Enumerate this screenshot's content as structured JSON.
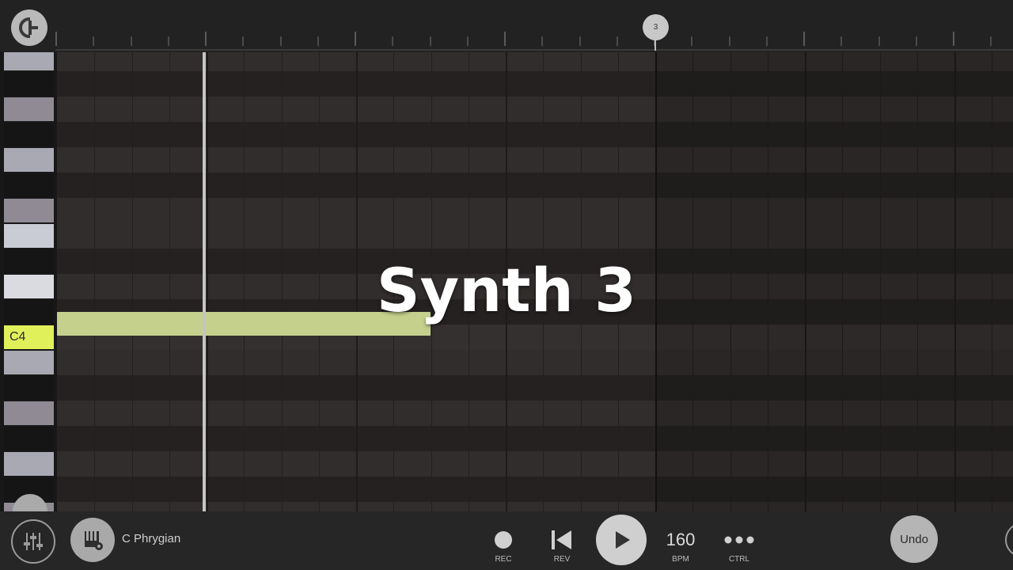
{
  "timeline": {
    "bar_marker_label": "3"
  },
  "piano": {
    "highlighted_key_label": "C4",
    "highlight_color": "#dff05a"
  },
  "overlay": {
    "title": "Synth 3"
  },
  "note": {
    "pitch": "C4",
    "color": "#c5d08c"
  },
  "toolbar": {
    "scale_label": "C Phrygian",
    "rec_label": "REC",
    "rev_label": "REV",
    "bpm_value": "160",
    "bpm_label": "BPM",
    "ctrl_label": "CTRL",
    "undo_label": "Undo"
  },
  "icons": {
    "logo": "app-logo-icon",
    "mixer": "mixer-sliders-icon",
    "scale": "piano-gear-icon",
    "record": "record-dot-icon",
    "rewind": "skip-back-icon",
    "play": "play-icon",
    "ctrl": "more-dots-icon"
  }
}
